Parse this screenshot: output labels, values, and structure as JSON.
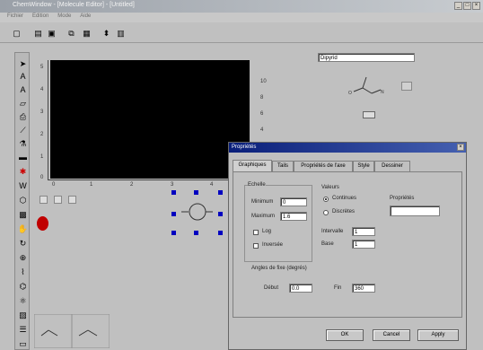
{
  "window": {
    "title": "ChemWindow - [Molecule Editor] - [Untitled]"
  },
  "menu": [
    "Fichier",
    "Edition",
    "Mode",
    "Aide"
  ],
  "toolbar_icons": [
    "new-icon",
    "open-icon",
    "save-icon",
    "copy-icon",
    "paste-icon",
    "arrow-icon",
    "grid-icon"
  ],
  "left_tools": [
    "pointer-icon",
    "text-icon",
    "text-a-icon",
    "eraser-icon",
    "printer-icon",
    "bond-icon",
    "flask-icon",
    "rect-icon",
    "star-icon",
    "w-icon",
    "ring-icon",
    "template-icon",
    "hand-icon",
    "rotate-icon",
    "zoom-icon",
    "chain-icon",
    "ring2-icon",
    "atom-icon",
    "graph-icon",
    "list-icon",
    "end-icon"
  ],
  "plot": {
    "y_ticks": [
      "5",
      "4",
      "3",
      "2",
      "1",
      "0"
    ],
    "x_ticks": [
      "0",
      "1",
      "2",
      "3",
      "4"
    ],
    "right_ticks": [
      "10",
      "8",
      "6",
      "4",
      "2"
    ]
  },
  "top_right": {
    "field_value": "Dipyrid"
  },
  "dialog": {
    "title": "Propriétés",
    "close": "×",
    "tabs": [
      "Graphiques",
      "Tails",
      "Propriétés de l'axe",
      "Style",
      "Dessiner"
    ],
    "active_tab": 0,
    "echelle_label": "Echelle",
    "minimum_label": "Minimum",
    "minimum_value": "0",
    "maximum_label": "Maximum",
    "maximum_value": "1.6",
    "log_label": "Log",
    "inverse_label": "Inversée",
    "valeurs_label": "Valeurs",
    "continues_label": "Continues",
    "discretes_label": "Discrètes",
    "intervalle_label": "Intervalle",
    "intervalle_value": "1",
    "base_label": "Base",
    "base_value": "1",
    "proprietes_label": "Propriétés",
    "proprietes_value": "",
    "angles_label": "Angles de fixe (degrés)",
    "debut_label": "Début",
    "debut_value": "0.0",
    "fin_label": "Fin",
    "fin_value": "360",
    "ok": "OK",
    "cancel": "Cancel",
    "apply": "Apply"
  }
}
